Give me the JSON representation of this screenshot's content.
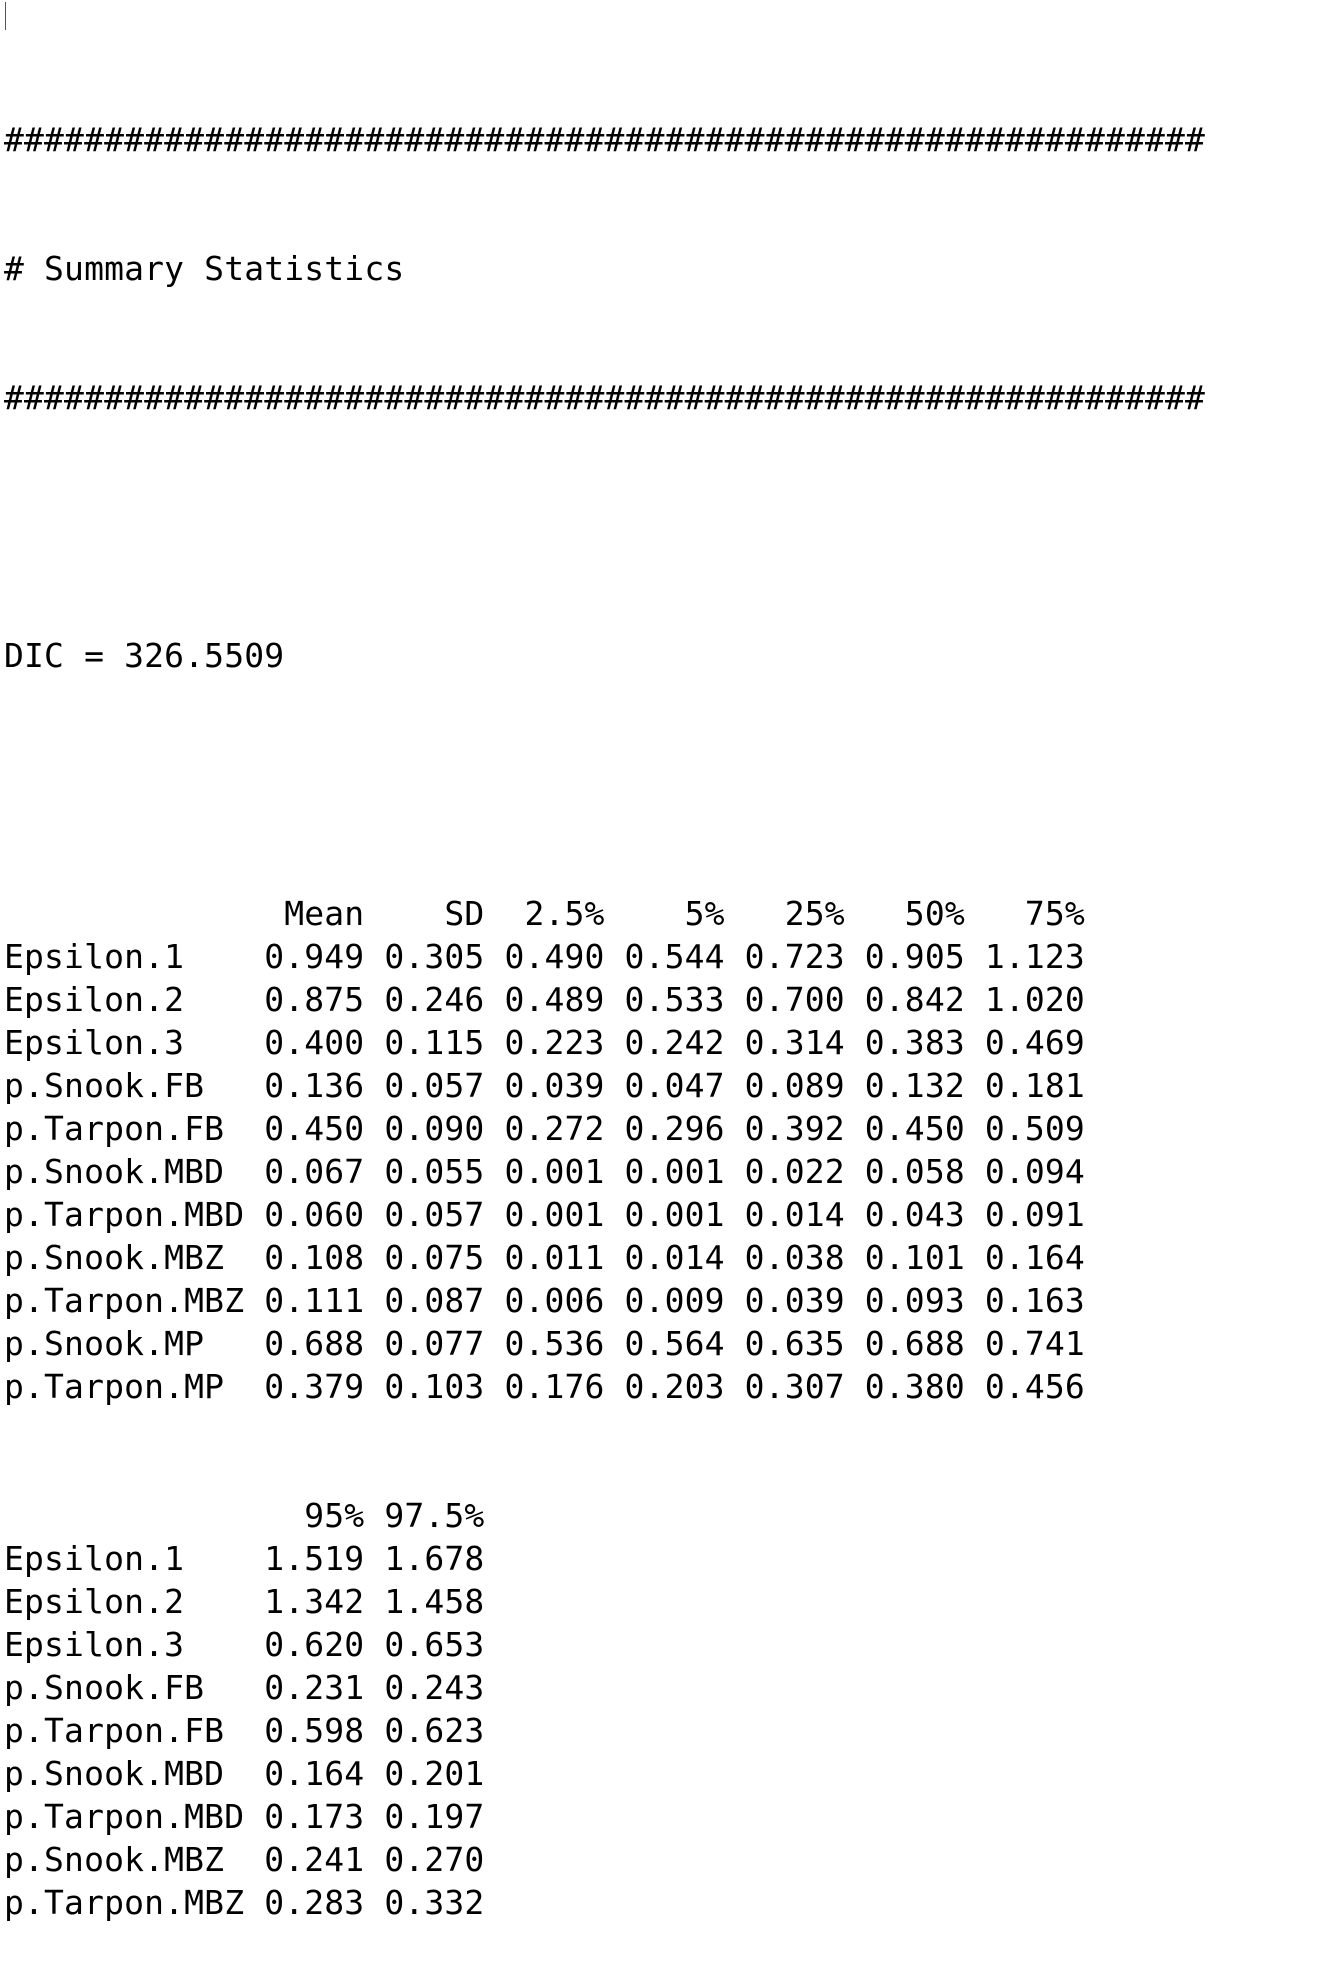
{
  "output": {
    "rule_top": "############################################################",
    "header": "# Summary Statistics",
    "rule_bottom": "############################################################",
    "dic": "DIC = 326.5509",
    "table1": {
      "columns": [
        "Mean",
        "SD",
        "2.5%",
        "5%",
        "25%",
        "50%",
        "75%"
      ],
      "rows": [
        {
          "name": "Epsilon.1",
          "values": [
            "0.949",
            "0.305",
            "0.490",
            "0.544",
            "0.723",
            "0.905",
            "1.123"
          ]
        },
        {
          "name": "Epsilon.2",
          "values": [
            "0.875",
            "0.246",
            "0.489",
            "0.533",
            "0.700",
            "0.842",
            "1.020"
          ]
        },
        {
          "name": "Epsilon.3",
          "values": [
            "0.400",
            "0.115",
            "0.223",
            "0.242",
            "0.314",
            "0.383",
            "0.469"
          ]
        },
        {
          "name": "p.Snook.FB",
          "values": [
            "0.136",
            "0.057",
            "0.039",
            "0.047",
            "0.089",
            "0.132",
            "0.181"
          ]
        },
        {
          "name": "p.Tarpon.FB",
          "values": [
            "0.450",
            "0.090",
            "0.272",
            "0.296",
            "0.392",
            "0.450",
            "0.509"
          ]
        },
        {
          "name": "p.Snook.MBD",
          "values": [
            "0.067",
            "0.055",
            "0.001",
            "0.001",
            "0.022",
            "0.058",
            "0.094"
          ]
        },
        {
          "name": "p.Tarpon.MBD",
          "values": [
            "0.060",
            "0.057",
            "0.001",
            "0.001",
            "0.014",
            "0.043",
            "0.091"
          ]
        },
        {
          "name": "p.Snook.MBZ",
          "values": [
            "0.108",
            "0.075",
            "0.011",
            "0.014",
            "0.038",
            "0.101",
            "0.164"
          ]
        },
        {
          "name": "p.Tarpon.MBZ",
          "values": [
            "0.111",
            "0.087",
            "0.006",
            "0.009",
            "0.039",
            "0.093",
            "0.163"
          ]
        },
        {
          "name": "p.Snook.MP",
          "values": [
            "0.688",
            "0.077",
            "0.536",
            "0.564",
            "0.635",
            "0.688",
            "0.741"
          ]
        },
        {
          "name": "p.Tarpon.MP",
          "values": [
            "0.379",
            "0.103",
            "0.176",
            "0.203",
            "0.307",
            "0.380",
            "0.456"
          ]
        }
      ]
    },
    "table2": {
      "columns": [
        "95%",
        "97.5%"
      ],
      "rows": [
        {
          "name": "Epsilon.1",
          "values": [
            "1.519",
            "1.678"
          ]
        },
        {
          "name": "Epsilon.2",
          "values": [
            "1.342",
            "1.458"
          ]
        },
        {
          "name": "Epsilon.3",
          "values": [
            "0.620",
            "0.653"
          ]
        },
        {
          "name": "p.Snook.FB",
          "values": [
            "0.231",
            "0.243"
          ]
        },
        {
          "name": "p.Tarpon.FB",
          "values": [
            "0.598",
            "0.623"
          ]
        },
        {
          "name": "p.Snook.MBD",
          "values": [
            "0.164",
            "0.201"
          ]
        },
        {
          "name": "p.Tarpon.MBD",
          "values": [
            "0.173",
            "0.197"
          ]
        },
        {
          "name": "p.Snook.MBZ",
          "values": [
            "0.241",
            "0.270"
          ]
        },
        {
          "name": "p.Tarpon.MBZ",
          "values": [
            "0.283",
            "0.332"
          ]
        }
      ]
    }
  }
}
